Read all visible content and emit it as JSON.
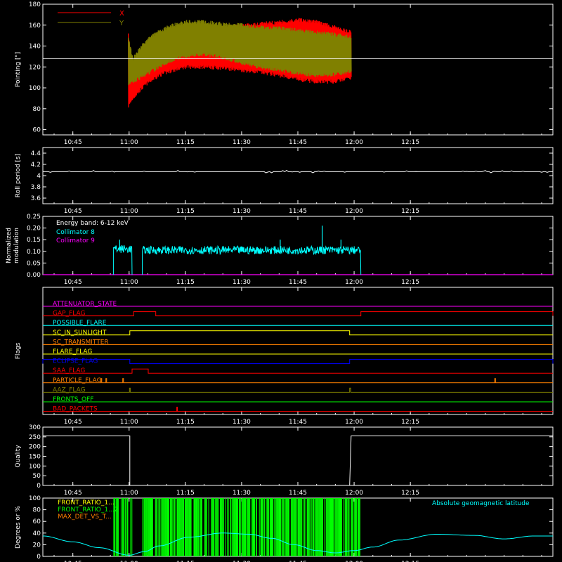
{
  "time_ticks": [
    "10:45",
    "11:00",
    "11:15",
    "11:30",
    "11:45",
    "12:00",
    "12:15"
  ],
  "time_tick_minutes": [
    645,
    660,
    675,
    690,
    705,
    720,
    735
  ],
  "xlim_minutes": [
    637,
    773
  ],
  "chart_data": [
    {
      "type": "area",
      "ylabel": "Pointing [\"]",
      "ylim": [
        55,
        180
      ],
      "yticks": [
        60,
        80,
        100,
        120,
        140,
        160,
        180
      ],
      "reference_line": 128,
      "legend_position": "top-left",
      "legend": [
        {
          "name": "X",
          "color": "#ff0000"
        },
        {
          "name": "Y",
          "color": "#808000"
        }
      ],
      "data_start_minutes": 659.8,
      "data_end_minutes": 719.3,
      "series": [
        {
          "name": "X",
          "color": "#ff0000",
          "x": [
            659.8,
            661,
            663,
            665,
            668,
            671,
            675,
            680,
            685,
            690,
            695,
            700,
            705,
            710,
            715,
            719.3
          ],
          "upper": [
            152,
            125,
            132,
            138,
            146,
            152,
            157,
            160,
            160,
            161,
            163,
            165,
            167,
            165,
            160,
            155
          ],
          "lower": [
            80,
            88,
            96,
            103,
            110,
            114,
            118,
            118,
            117,
            115,
            113,
            110,
            106,
            104,
            104,
            108
          ]
        },
        {
          "name": "Y",
          "color": "#808000",
          "x": [
            659.8,
            661,
            663,
            665,
            668,
            671,
            675,
            680,
            685,
            690,
            695,
            700,
            705,
            710,
            715,
            719.3
          ],
          "upper": [
            150,
            130,
            140,
            149,
            156,
            161,
            165,
            165,
            163,
            162,
            160,
            159,
            157,
            155,
            153,
            150
          ],
          "lower": [
            100,
            104,
            108,
            112,
            118,
            124,
            128,
            130,
            127,
            122,
            118,
            115,
            112,
            110,
            111,
            114
          ]
        }
      ]
    },
    {
      "type": "line",
      "ylabel": "Roll period [s]",
      "ylim": [
        3.5,
        4.5
      ],
      "yticks": [
        3.6,
        3.8,
        4.0,
        4.2,
        4.4
      ],
      "series": [
        {
          "name": "",
          "color": "#ffffff",
          "value": 4.07
        }
      ]
    },
    {
      "type": "line",
      "ylabel": "Normalized modulation",
      "ylim": [
        0,
        0.25
      ],
      "yticks": [
        "0.00",
        "0.05",
        "0.10",
        "0.15",
        "0.20",
        "0.25"
      ],
      "annotation": "Energy band: 6-12 keV",
      "legend": [
        {
          "name": "Collimator 8",
          "color": "#00ffff"
        },
        {
          "name": "Collimator 9",
          "color": "#ff00ff"
        }
      ],
      "series": [
        {
          "name": "Collimator 8",
          "color": "#00ffff",
          "segments": [
            {
              "start": 655.8,
              "end": 660.8,
              "level": 0.11
            },
            {
              "start": 663.5,
              "end": 721.8,
              "level": 0.105
            }
          ],
          "spikes": [
            {
              "x": 657.5,
              "value": 0.15
            },
            {
              "x": 700.3,
              "value": 0.15
            },
            {
              "x": 711.5,
              "value": 0.21
            },
            {
              "x": 716.5,
              "value": 0.15
            }
          ]
        },
        {
          "name": "Collimator 9",
          "color": "#ff00ff",
          "value": 0.0
        }
      ]
    },
    {
      "type": "line",
      "ylabel": "Flags",
      "flags": [
        {
          "name": "ATTENUATOR_STATE",
          "color": "#ff00ff",
          "pulses": []
        },
        {
          "name": "GAP_FLAG",
          "color": "#ff0000",
          "pulses": [
            [
              661.2,
              667.1
            ],
            [
              721.8,
              773
            ]
          ]
        },
        {
          "name": "POSSIBLE_FLARE",
          "color": "#00ffff",
          "pulses": []
        },
        {
          "name": "SC_IN_SUNLIGHT",
          "color": "#ffff00",
          "pulses": [
            [
              660.2,
              718.8
            ]
          ]
        },
        {
          "name": "SC_TRANSMITTER",
          "color": "#ff8000",
          "pulses": []
        },
        {
          "name": "FLARE_FLAG",
          "color": "#ffff00",
          "pulses": []
        },
        {
          "name": "ECLIPSE_FLAG",
          "color": "#0000ff",
          "pulses": [
            [
              637,
              660.2
            ],
            [
              718.8,
              773
            ]
          ]
        },
        {
          "name": "SAA_FLAG",
          "color": "#ff0000",
          "pulses": [
            [
              660.8,
              665.1
            ]
          ]
        },
        {
          "name": "PARTICLE_FLAG",
          "color": "#ff8000",
          "pulses": [
            [
              652.5,
              652.7
            ],
            [
              653.8,
              654.0
            ],
            [
              658.3,
              658.5
            ],
            [
              757.5,
              757.7
            ]
          ]
        },
        {
          "name": "AAZ_FLAG",
          "color": "#808000",
          "pulses": [
            [
              660.1,
              660.3
            ],
            [
              718.8,
              719.1
            ]
          ]
        },
        {
          "name": "FRONTS_OFF",
          "color": "#00ff00",
          "pulses": []
        },
        {
          "name": "BAD_PACKETS",
          "color": "#ff0000",
          "pulses": [
            [
              672.7,
              672.9
            ]
          ]
        }
      ]
    },
    {
      "type": "line",
      "ylabel": "Quality",
      "ylim": [
        0,
        300
      ],
      "yticks": [
        0,
        50,
        100,
        150,
        200,
        250,
        300
      ],
      "series": [
        {
          "name": "",
          "color": "#ffffff",
          "x": [
            637,
            660.2,
            660.2,
            718.8,
            719.2,
            773
          ],
          "y": [
            255,
            255,
            0,
            0,
            255,
            255
          ]
        }
      ]
    },
    {
      "type": "area",
      "ylabel": "Degrees or %",
      "ylim": [
        0,
        100
      ],
      "yticks": [
        0,
        20,
        40,
        60,
        80,
        100
      ],
      "legend": [
        {
          "name": "FRONT_RATIO_1...",
          "color": "#ffff00"
        },
        {
          "name": "FRONT_RATIO_1...2",
          "color": "#00ff00"
        },
        {
          "name": "MAX_DET_VS_T...",
          "color": "#ff8000"
        }
      ],
      "annotation": "Absolute geomagnetic latitude",
      "series": [
        {
          "name": "FRONT_RATIO_1...2",
          "color": "#00ff00",
          "segments": [
            [
              655.8,
              660.8
            ],
            [
              663.5,
              721.8
            ]
          ],
          "value": 100
        },
        {
          "name": "Absolute geomagnetic latitude",
          "color": "#00ffff",
          "x": [
            637,
            645,
            652,
            660,
            664,
            668,
            676,
            685,
            692,
            698,
            704,
            710,
            715,
            720,
            725,
            732,
            742,
            752,
            760,
            768,
            773
          ],
          "y": [
            35,
            25,
            15,
            2,
            8,
            18,
            33,
            40,
            38,
            31,
            20,
            10,
            6,
            10,
            16,
            28,
            38,
            36,
            30,
            35,
            35
          ]
        }
      ]
    }
  ]
}
